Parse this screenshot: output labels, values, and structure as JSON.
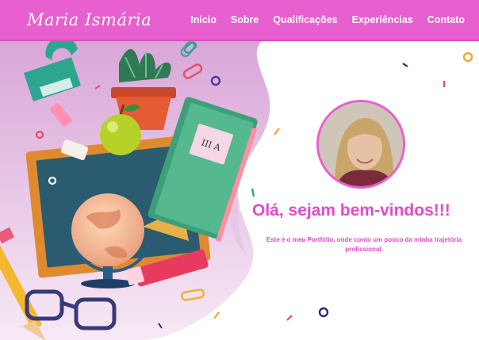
{
  "header": {
    "brand": "Maria Ismária",
    "nav": [
      "Inicio",
      "Sobre",
      "Qualificações",
      "Experiências",
      "Contato"
    ]
  },
  "hero": {
    "book_label": "III A",
    "welcome": "Olá, sejam bem-vindos!!!",
    "intro": "Este é o meu Portfólio, onde conto um pouco da minha trajetória profissional."
  },
  "colors": {
    "nav_bg": "#e85fcf",
    "accent_text": "#e24ac8",
    "avatar_border": "#e85fcf"
  },
  "icons": [
    "protractor-icon",
    "plant-icon",
    "book-icon",
    "apple-icon",
    "chalkboard-icon",
    "globe-icon",
    "pencil-icon",
    "marker-icon",
    "glasses-icon",
    "paperclip-icon",
    "eraser-icon"
  ]
}
